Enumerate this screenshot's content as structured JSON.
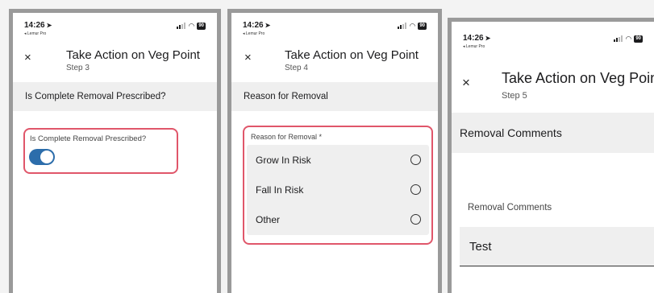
{
  "status_bar": {
    "time": "14:26",
    "back_label": "◂ Lemur Pro",
    "battery": "90"
  },
  "screens": [
    {
      "close_glyph": "×",
      "title": "Take Action on Veg Point",
      "step": "Step 3",
      "section": "Is Complete Removal Prescribed?",
      "field_label": "Is Complete Removal Prescribed?",
      "toggle_on": true
    },
    {
      "close_glyph": "×",
      "title": "Take Action on Veg Point",
      "step": "Step 4",
      "section": "Reason for Removal",
      "field_label": "Reason for Removal *",
      "options": [
        "Grow In Risk",
        "Fall In Risk",
        "Other"
      ]
    },
    {
      "close_glyph": "×",
      "title": "Take Action on Veg Point",
      "step": "Step 5",
      "section": "Removal Comments",
      "field_label": "Removal Comments",
      "field_value": "Test"
    }
  ],
  "colors": {
    "highlight": "#e0566a",
    "toggle_on": "#2c6dab",
    "section_bg": "#efefef"
  },
  "icons": {
    "location_arrow": "location-arrow-icon",
    "signal": "cellular-signal-icon",
    "wifi": "wifi-icon",
    "battery": "battery-icon",
    "close": "close-icon",
    "radio": "radio-unchecked-icon"
  }
}
